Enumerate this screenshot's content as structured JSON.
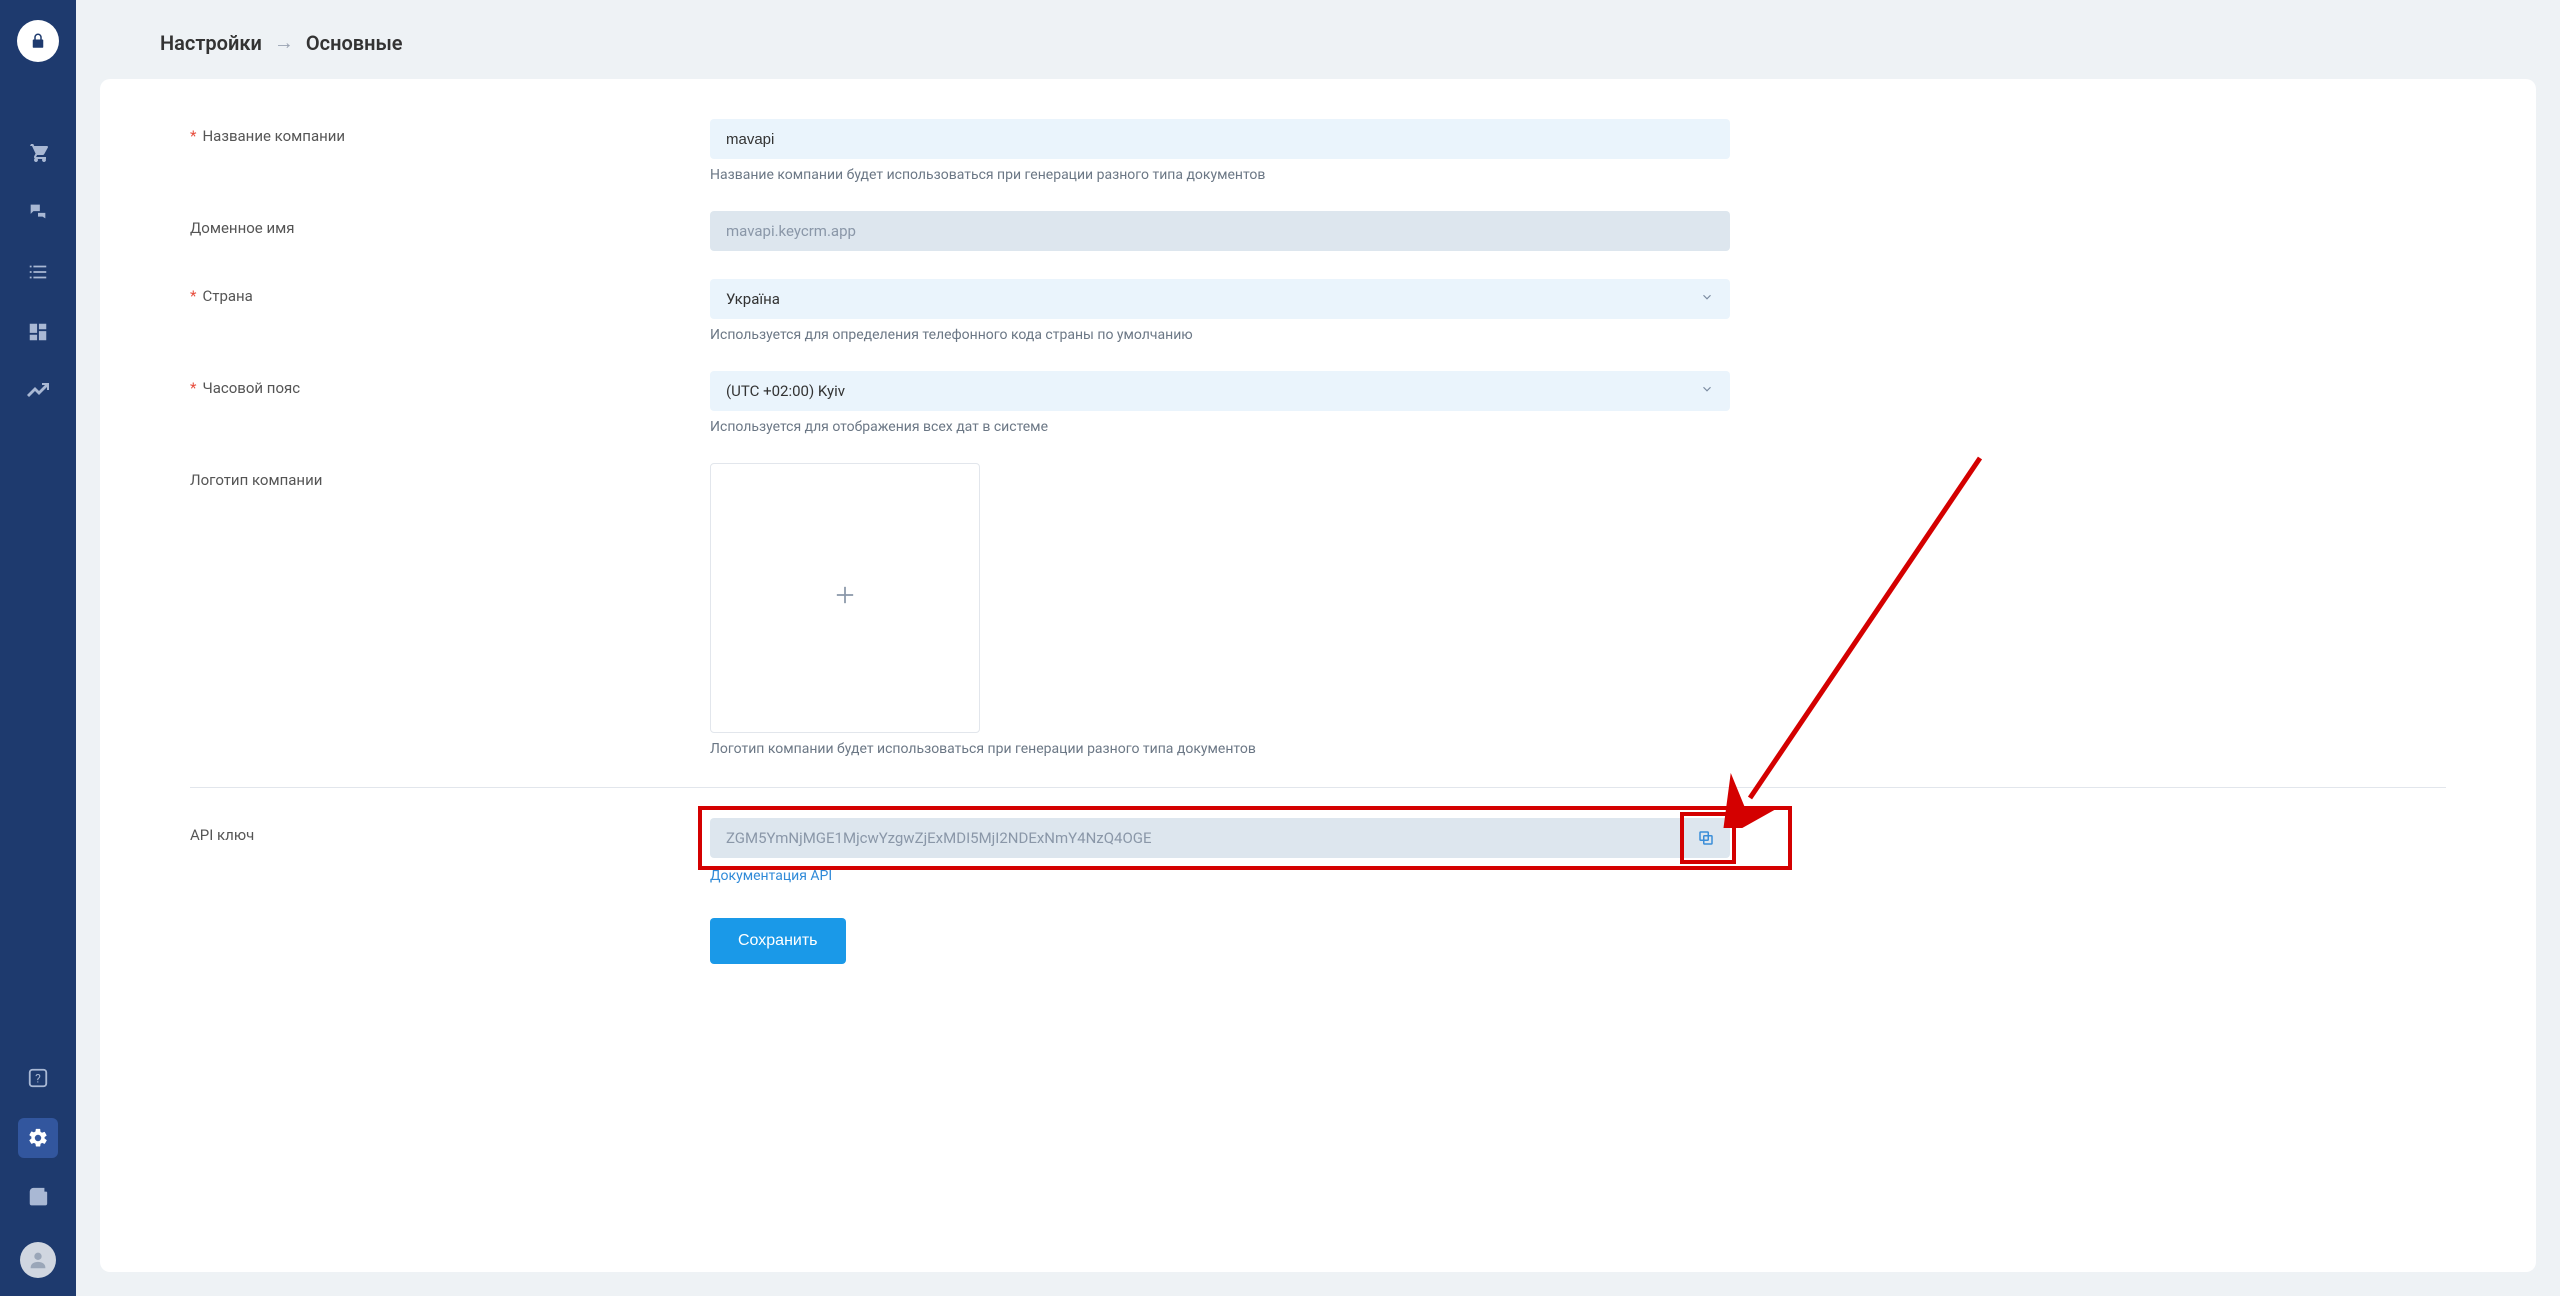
{
  "breadcrumb": {
    "root": "Настройки",
    "current": "Основные"
  },
  "labels": {
    "company_name": "Название компании",
    "domain": "Доменное имя",
    "country": "Страна",
    "timezone": "Часовой пояс",
    "logo": "Логотип компании",
    "api_key": "API ключ"
  },
  "values": {
    "company_name": "mavapi",
    "domain": "mavapi.keycrm.app",
    "country": "Україна",
    "timezone": "(UTC +02:00) Kyiv",
    "api_key": "ZGM5YmNjMGE1MjcwYzgwZjExMDI5MjI2NDExNmY4NzQ4OGE"
  },
  "helpers": {
    "company_name": "Название компании будет использоваться при генерации разного типа документов",
    "country": "Используется для определения телефонного кода страны по умолчанию",
    "timezone": "Используется для отображения всех дат в системе",
    "logo": "Логотип компании будет использоваться при генерации разного типа документов"
  },
  "links": {
    "api_doc": "Документация API"
  },
  "buttons": {
    "save": "Сохранить"
  }
}
